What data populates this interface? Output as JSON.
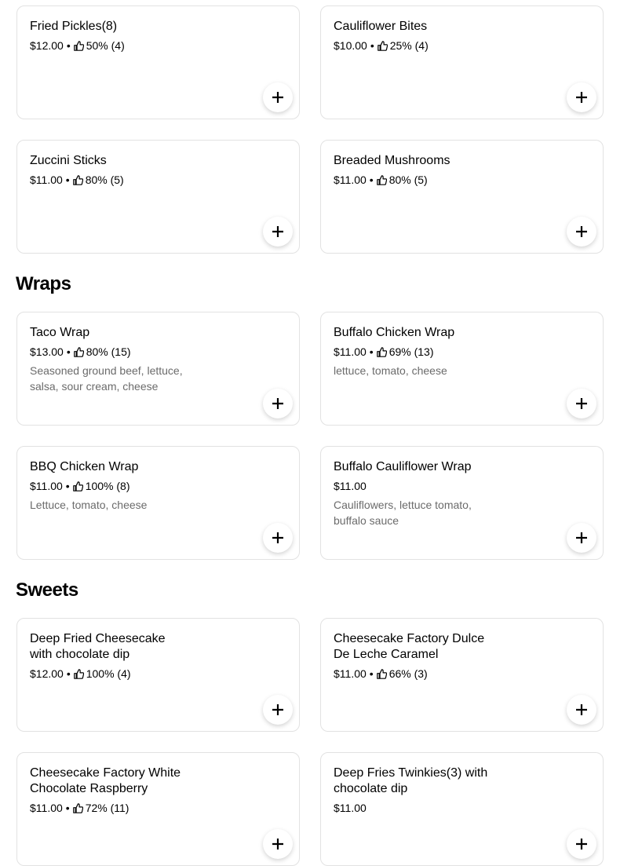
{
  "sections": {
    "wraps_title": "Wraps",
    "sweets_title": "Sweets"
  },
  "items": [
    {
      "name": "Fried Pickles(8)",
      "price": "$12.00",
      "rating": "50% (4)",
      "desc": ""
    },
    {
      "name": "Cauliflower Bites",
      "price": "$10.00",
      "rating": "25% (4)",
      "desc": ""
    },
    {
      "name": "Zuccini Sticks",
      "price": "$11.00",
      "rating": "80% (5)",
      "desc": ""
    },
    {
      "name": "Breaded Mushrooms",
      "price": "$11.00",
      "rating": "80% (5)",
      "desc": ""
    },
    {
      "name": "Taco Wrap",
      "price": "$13.00",
      "rating": "80% (15)",
      "desc": "Seasoned ground beef, lettuce, salsa, sour cream, cheese"
    },
    {
      "name": "Buffalo Chicken Wrap",
      "price": "$11.00",
      "rating": "69% (13)",
      "desc": "lettuce, tomato, cheese"
    },
    {
      "name": "BBQ Chicken Wrap",
      "price": "$11.00",
      "rating": "100% (8)",
      "desc": "Lettuce, tomato, cheese"
    },
    {
      "name": "Buffalo Cauliflower Wrap",
      "price": "$11.00",
      "rating": "",
      "desc": "Cauliflowers, lettuce tomato, buffalo sauce"
    },
    {
      "name": "Deep Fried Cheesecake with chocolate dip",
      "price": "$12.00",
      "rating": "100% (4)",
      "desc": ""
    },
    {
      "name": "Cheesecake Factory Dulce De Leche Caramel",
      "price": "$11.00",
      "rating": "66% (3)",
      "desc": ""
    },
    {
      "name": "Cheesecake Factory White Chocolate Raspberry",
      "price": "$11.00",
      "rating": "72% (11)",
      "desc": ""
    },
    {
      "name": "Deep Fries Twinkies(3) with chocolate dip",
      "price": "$11.00",
      "rating": "",
      "desc": ""
    }
  ],
  "icons": {
    "rating": "thumbs-up-icon",
    "add": "plus-icon"
  },
  "colors": {
    "border": "#e2e2e2",
    "secondary_text": "#6b6b6b"
  }
}
